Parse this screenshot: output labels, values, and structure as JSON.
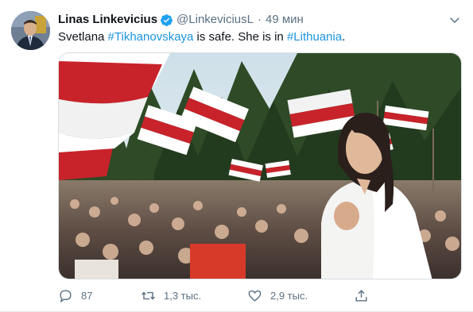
{
  "tweet": {
    "author": {
      "display_name": "Linas Linkevicius",
      "handle": "@LinkeviciusL",
      "verified": true,
      "verified_icon": "verified-badge-icon"
    },
    "separator": "·",
    "timestamp": "49 мин",
    "text": {
      "part1": "Svetlana ",
      "hashtag1": "#Tikhanovskaya",
      "part2": " is safe. She is in ",
      "hashtag2": "#Lithuania",
      "part3": "."
    },
    "colors": {
      "link": "#1b95e0",
      "secondary_text": "#5b7083",
      "verified": "#1da1f2"
    },
    "actions": {
      "reply_count": "87",
      "retweet_count": "1,3 тыс.",
      "like_count": "2,9 тыс.",
      "reply_icon": "reply-icon",
      "retweet_icon": "retweet-icon",
      "like_icon": "heart-icon",
      "share_icon": "share-icon"
    }
  }
}
